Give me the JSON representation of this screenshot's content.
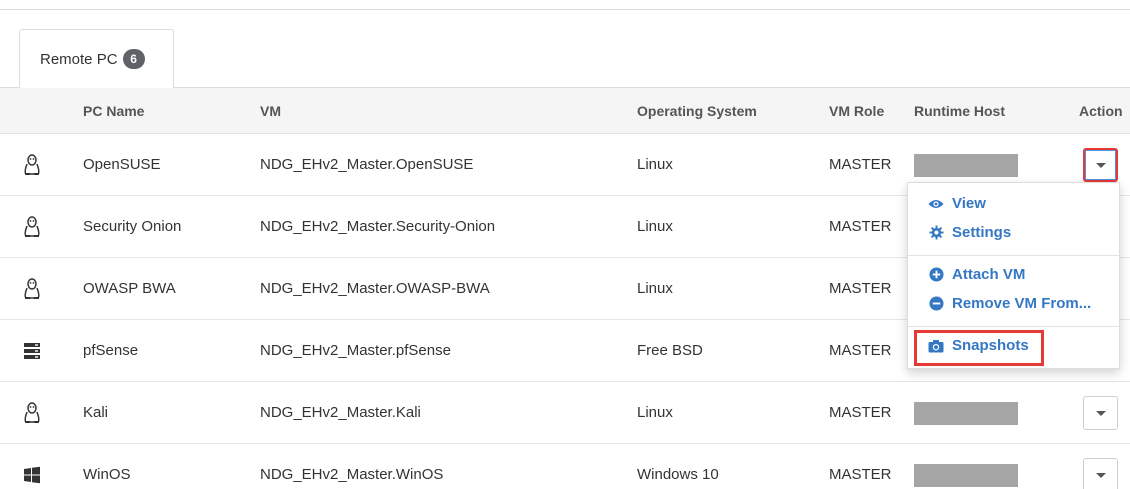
{
  "tab": {
    "label": "Remote PC",
    "count": "6"
  },
  "columns": {
    "pc_name": "PC Name",
    "vm": "VM",
    "os": "Operating System",
    "role": "VM Role",
    "host": "Runtime Host",
    "action": "Action"
  },
  "rows": [
    {
      "icon": "linux-icon",
      "pc_name": "OpenSUSE",
      "vm": "NDG_EHv2_Master.OpenSUSE",
      "os": "Linux",
      "role": "MASTER"
    },
    {
      "icon": "linux-icon",
      "pc_name": "Security Onion",
      "vm": "NDG_EHv2_Master.Security-Onion",
      "os": "Linux",
      "role": "MASTER"
    },
    {
      "icon": "linux-icon",
      "pc_name": "OWASP BWA",
      "vm": "NDG_EHv2_Master.OWASP-BWA",
      "os": "Linux",
      "role": "MASTER"
    },
    {
      "icon": "server-icon",
      "pc_name": "pfSense",
      "vm": "NDG_EHv2_Master.pfSense",
      "os": "Free BSD",
      "role": "MASTER"
    },
    {
      "icon": "linux-icon",
      "pc_name": "Kali",
      "vm": "NDG_EHv2_Master.Kali",
      "os": "Linux",
      "role": "MASTER"
    },
    {
      "icon": "windows-icon",
      "pc_name": "WinOS",
      "vm": "NDG_EHv2_Master.WinOS",
      "os": "Windows 10",
      "role": "MASTER"
    }
  ],
  "menu": {
    "view": "View",
    "settings": "Settings",
    "attach": "Attach VM",
    "remove": "Remove VM From...",
    "snapshots": "Snapshots"
  },
  "colors": {
    "link": "#3478c4",
    "highlight": "#e53935",
    "redacted": "#a5a5a5"
  }
}
